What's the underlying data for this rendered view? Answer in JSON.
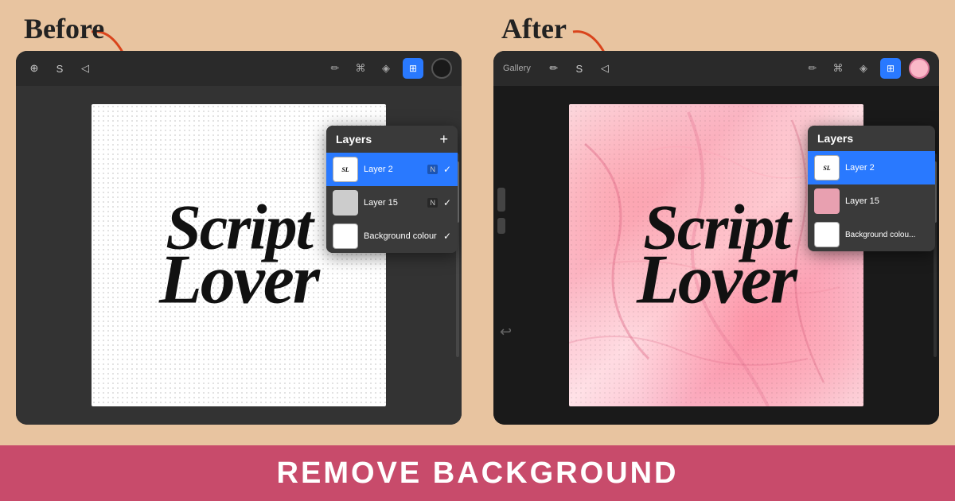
{
  "labels": {
    "before": "Before",
    "after": "After",
    "banner": "REMOVE BACKGROUND"
  },
  "layers": {
    "title": "Layers",
    "add_icon": "+",
    "items": [
      {
        "name": "Layer 2",
        "badge": "N",
        "active": true
      },
      {
        "name": "Layer 15",
        "badge": "N",
        "active": false
      },
      {
        "name": "Background colour",
        "badge": "",
        "active": false
      }
    ]
  },
  "toolbar": {
    "gallery": "Gallery",
    "icons": [
      "✏️",
      "✦",
      "S",
      "✦"
    ]
  },
  "script_text_line1": "Script",
  "script_text_line2": "Lover"
}
